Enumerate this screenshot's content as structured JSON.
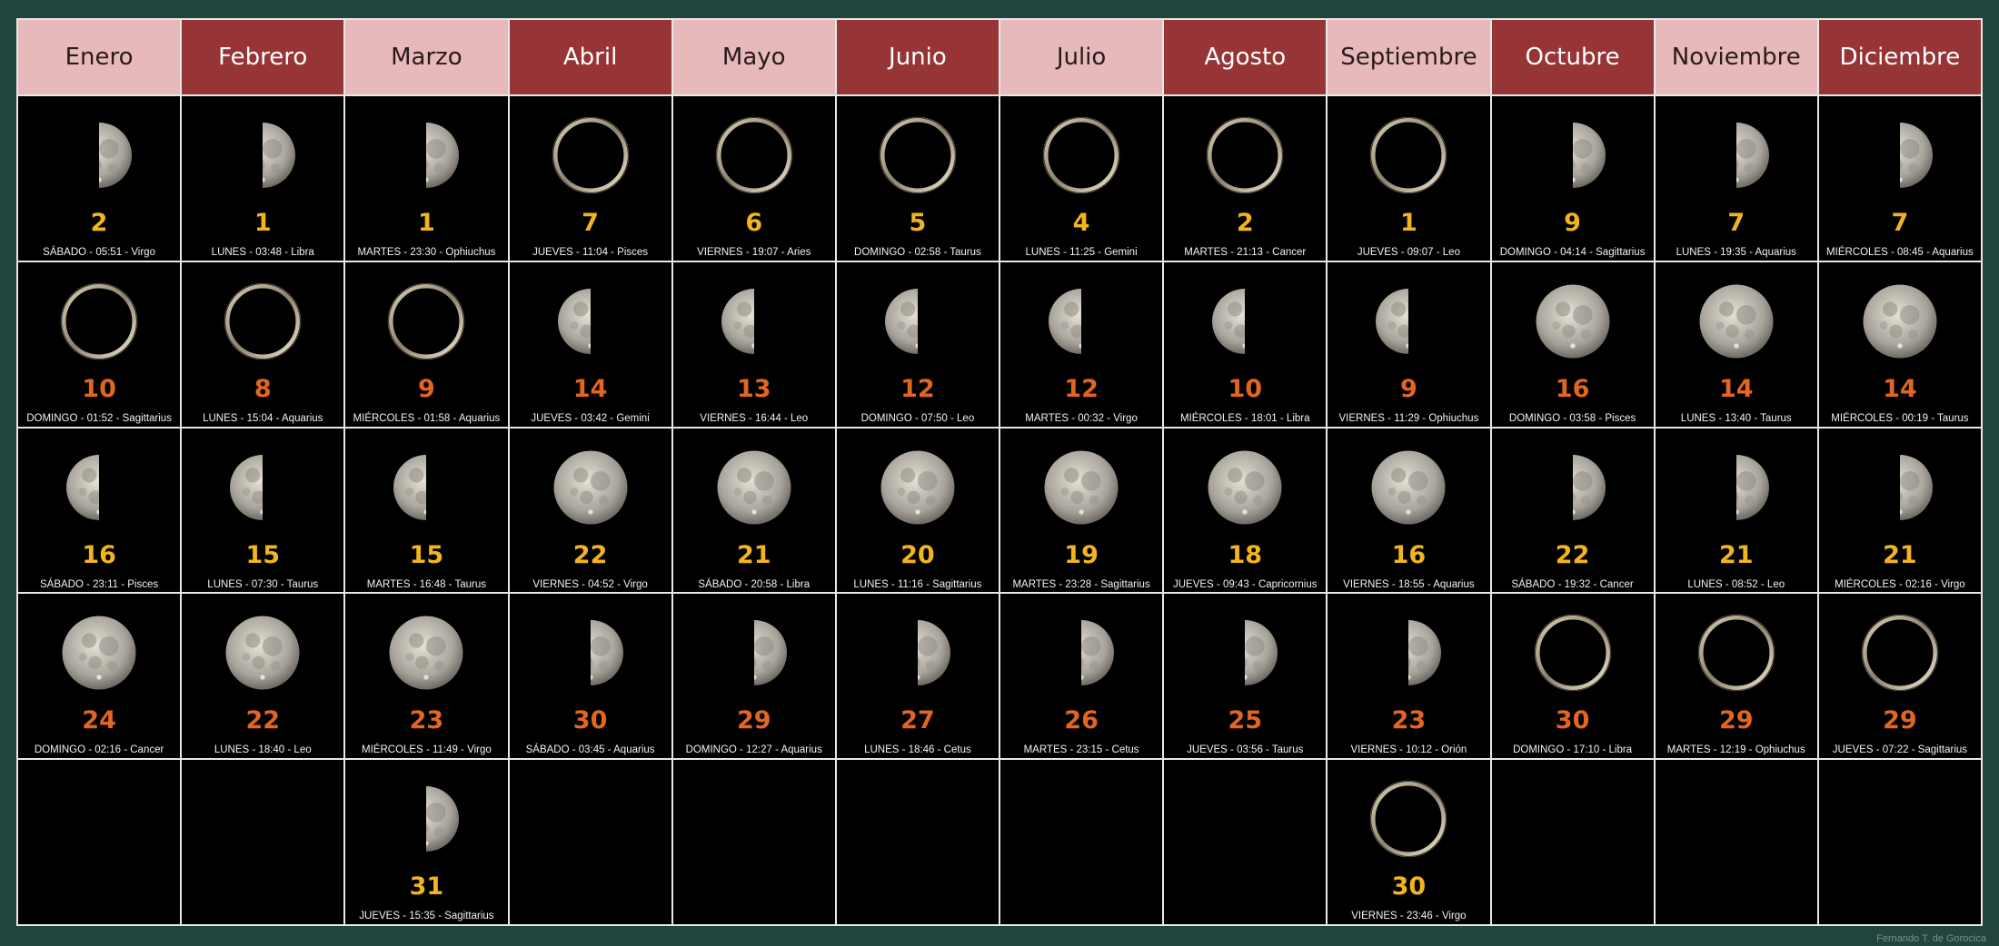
{
  "months": [
    {
      "name": "Enero",
      "style": "light"
    },
    {
      "name": "Febrero",
      "style": "dark"
    },
    {
      "name": "Marzo",
      "style": "light"
    },
    {
      "name": "Abril",
      "style": "dark"
    },
    {
      "name": "Mayo",
      "style": "light"
    },
    {
      "name": "Junio",
      "style": "dark"
    },
    {
      "name": "Julio",
      "style": "light"
    },
    {
      "name": "Agosto",
      "style": "dark"
    },
    {
      "name": "Septiembre",
      "style": "light"
    },
    {
      "name": "Octubre",
      "style": "dark"
    },
    {
      "name": "Noviembre",
      "style": "light"
    },
    {
      "name": "Diciembre",
      "style": "dark"
    }
  ],
  "rows": [
    [
      {
        "phase": "first-quarter",
        "day": "2",
        "color": "yellow",
        "detail": "SÁBADO - 05:51 - Virgo"
      },
      {
        "phase": "first-quarter",
        "day": "1",
        "color": "yellow",
        "detail": "LUNES - 03:48 - Libra"
      },
      {
        "phase": "first-quarter",
        "day": "1",
        "color": "yellow",
        "detail": "MARTES - 23:30 - Ophiuchus"
      },
      {
        "phase": "new",
        "day": "7",
        "color": "yellow",
        "detail": "JUEVES - 11:04 - Pisces"
      },
      {
        "phase": "new",
        "day": "6",
        "color": "yellow",
        "detail": "VIERNES - 19:07 - Aries"
      },
      {
        "phase": "new",
        "day": "5",
        "color": "yellow",
        "detail": "DOMINGO - 02:58 - Taurus"
      },
      {
        "phase": "new",
        "day": "4",
        "color": "yellow",
        "detail": "LUNES - 11:25 - Gemini"
      },
      {
        "phase": "new",
        "day": "2",
        "color": "yellow",
        "detail": "MARTES - 21:13 - Cancer"
      },
      {
        "phase": "new",
        "day": "1",
        "color": "yellow",
        "detail": "JUEVES - 09:07 - Leo"
      },
      {
        "phase": "first-quarter",
        "day": "9",
        "color": "yellow",
        "detail": "DOMINGO - 04:14 - Sagittarius"
      },
      {
        "phase": "first-quarter",
        "day": "7",
        "color": "yellow",
        "detail": "LUNES - 19:35 - Aquarius"
      },
      {
        "phase": "first-quarter",
        "day": "7",
        "color": "yellow",
        "detail": "MIÉRCOLES - 08:45 - Aquarius"
      }
    ],
    [
      {
        "phase": "new",
        "day": "10",
        "color": "orange",
        "detail": "DOMINGO - 01:52 - Sagittarius"
      },
      {
        "phase": "new",
        "day": "8",
        "color": "orange",
        "detail": "LUNES - 15:04 - Aquarius"
      },
      {
        "phase": "new",
        "day": "9",
        "color": "orange",
        "detail": "MIÉRCOLES - 01:58 - Aquarius"
      },
      {
        "phase": "last-quarter",
        "day": "14",
        "color": "orange",
        "detail": "JUEVES - 03:42 - Gemini"
      },
      {
        "phase": "last-quarter",
        "day": "13",
        "color": "orange",
        "detail": "VIERNES - 16:44 - Leo"
      },
      {
        "phase": "last-quarter",
        "day": "12",
        "color": "orange",
        "detail": "DOMINGO - 07:50 - Leo"
      },
      {
        "phase": "last-quarter",
        "day": "12",
        "color": "orange",
        "detail": "MARTES - 00:32 - Virgo"
      },
      {
        "phase": "last-quarter",
        "day": "10",
        "color": "orange",
        "detail": "MIÉRCOLES - 18:01 - Libra"
      },
      {
        "phase": "last-quarter",
        "day": "9",
        "color": "orange",
        "detail": "VIERNES - 11:29 - Ophiuchus"
      },
      {
        "phase": "full",
        "day": "16",
        "color": "orange",
        "detail": "DOMINGO - 03:58 - Pisces"
      },
      {
        "phase": "full",
        "day": "14",
        "color": "orange",
        "detail": "LUNES - 13:40 - Taurus"
      },
      {
        "phase": "full",
        "day": "14",
        "color": "orange",
        "detail": "MIÉRCOLES - 00:19 - Taurus"
      }
    ],
    [
      {
        "phase": "last-quarter",
        "day": "16",
        "color": "yellow",
        "detail": "SÁBADO - 23:11 - Pisces"
      },
      {
        "phase": "last-quarter",
        "day": "15",
        "color": "yellow",
        "detail": "LUNES - 07:30 - Taurus"
      },
      {
        "phase": "last-quarter",
        "day": "15",
        "color": "yellow",
        "detail": "MARTES - 16:48 - Taurus"
      },
      {
        "phase": "full",
        "day": "22",
        "color": "yellow",
        "detail": "VIERNES - 04:52 - Virgo"
      },
      {
        "phase": "full",
        "day": "21",
        "color": "yellow",
        "detail": "SÁBADO - 20:58 - Libra"
      },
      {
        "phase": "full",
        "day": "20",
        "color": "yellow",
        "detail": "LUNES - 11:16 - Sagittarius"
      },
      {
        "phase": "full",
        "day": "19",
        "color": "yellow",
        "detail": "MARTES - 23:28 - Sagittarius"
      },
      {
        "phase": "full",
        "day": "18",
        "color": "yellow",
        "detail": "JUEVES - 09:43 - Capricornius"
      },
      {
        "phase": "full",
        "day": "16",
        "color": "yellow",
        "detail": "VIERNES - 18:55 - Aquarius"
      },
      {
        "phase": "first-quarter",
        "day": "22",
        "color": "yellow",
        "detail": "SÁBADO - 19:32 - Cancer"
      },
      {
        "phase": "first-quarter",
        "day": "21",
        "color": "yellow",
        "detail": "LUNES - 08:52 - Leo"
      },
      {
        "phase": "first-quarter",
        "day": "21",
        "color": "yellow",
        "detail": "MIÉRCOLES - 02:16 - Virgo"
      }
    ],
    [
      {
        "phase": "full",
        "day": "24",
        "color": "orange",
        "detail": "DOMINGO - 02:16 - Cancer"
      },
      {
        "phase": "full",
        "day": "22",
        "color": "orange",
        "detail": "LUNES - 18:40 - Leo"
      },
      {
        "phase": "full",
        "day": "23",
        "color": "orange",
        "detail": "MIÉRCOLES - 11:49 - Virgo"
      },
      {
        "phase": "first-quarter",
        "day": "30",
        "color": "orange",
        "detail": "SÁBADO - 03:45 - Aquarius"
      },
      {
        "phase": "first-quarter",
        "day": "29",
        "color": "orange",
        "detail": "DOMINGO - 12:27 - Aquarius"
      },
      {
        "phase": "first-quarter",
        "day": "27",
        "color": "orange",
        "detail": "LUNES - 18:46 - Cetus"
      },
      {
        "phase": "first-quarter",
        "day": "26",
        "color": "orange",
        "detail": "MARTES - 23:15 - Cetus"
      },
      {
        "phase": "first-quarter",
        "day": "25",
        "color": "orange",
        "detail": "JUEVES - 03:56 - Taurus"
      },
      {
        "phase": "first-quarter",
        "day": "23",
        "color": "orange",
        "detail": "VIERNES - 10:12 - Orión"
      },
      {
        "phase": "new",
        "day": "30",
        "color": "orange",
        "detail": "DOMINGO - 17:10 - Libra"
      },
      {
        "phase": "new",
        "day": "29",
        "color": "orange",
        "detail": "MARTES - 12:19 - Ophiuchus"
      },
      {
        "phase": "new",
        "day": "29",
        "color": "orange",
        "detail": "JUEVES - 07:22 - Sagittarius"
      }
    ],
    [
      null,
      null,
      {
        "phase": "first-quarter",
        "day": "31",
        "color": "yellow",
        "detail": "JUEVES - 15:35 - Sagittarius"
      },
      null,
      null,
      null,
      null,
      null,
      {
        "phase": "new",
        "day": "30",
        "color": "yellow",
        "detail": "VIERNES - 23:46 - Virgo"
      },
      null,
      null,
      null
    ]
  ],
  "credit": "Fernando T. de Gorocica",
  "colors": {
    "background": "#22443f",
    "header_light": "#e8b9bb",
    "header_dark": "#973435",
    "day_yellow": "#f2b51f",
    "day_orange": "#e2661f"
  }
}
